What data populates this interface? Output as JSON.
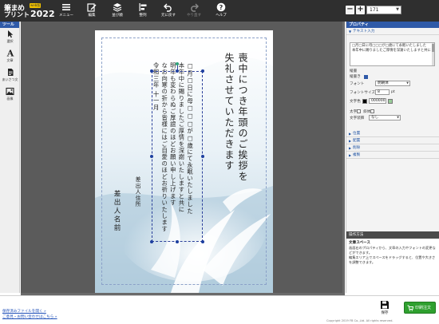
{
  "app": {
    "logo_line1": "筆まめ",
    "logo_line2": "プリント",
    "logo_tag": "web版",
    "logo_year": "2022"
  },
  "toolbar": {
    "menu": "メニュー",
    "edit": "編集",
    "layer": "並び順",
    "align": "整列",
    "undo": "元に戻す",
    "redo": "やり直す",
    "help": "ヘルプ",
    "zoom_value": "171"
  },
  "tools": {
    "header": "ツール",
    "select": "選択",
    "text": "文章",
    "greeting": "あいさつ文",
    "image": "画像"
  },
  "card": {
    "title_lines": [
      "喪中につき年頭のご挨拶を",
      "失礼させていただきます"
    ],
    "body_lines": [
      "本年中に賜りましたご厚情を深謝いたしますと共に",
      "明年も変わらぬご厚誼のほどお願い申し上げます",
      "なお向寒の折から皆様にはご自愛のほどお祈りいたします"
    ],
    "body_head": "□月□日に母□□□が□歳にて永眠いたしました",
    "date": "令和三年 十一月",
    "sender_address": "差出人住所",
    "sender_name": "差出人名前"
  },
  "properties": {
    "header": "プロパティ",
    "text_input_section": "テキスト入力",
    "text_content": "□月□日に母□□□が□歳にて永眠いたしました\n本年中に賜りましたご厚情を深謝いたしますと共に",
    "vertical_label": "縦書",
    "vertical_checkbox_label": "縦書き",
    "font_label": "フォント",
    "font_value": "明朝体",
    "font_size_label": "フォントサイズ",
    "font_size_value": "8",
    "font_size_unit": "pt",
    "text_color_label": "文字色",
    "text_color_value": "000000",
    "bold_label": "太字",
    "italic_label": "斜体",
    "decoration_label": "文字装飾",
    "decoration_value": "なし",
    "sections": [
      "位置",
      "配置",
      "削除",
      "複製"
    ]
  },
  "help": {
    "header": "操作方法",
    "title": "文章スペース",
    "body": "画面右のプロパティから、文章の入力やフォントの変更などができます。\n編集エリア上でスペースをドラッグすると、位置や大きさを調整できます。"
  },
  "bottom": {
    "link_open": "保存済みファイルを開く »",
    "link_sample": "ご意見・お問い合わせはこちら »",
    "save": "保存",
    "print": "印刷注文",
    "copyright": "Copyright 2019 FB Co.,Ltd. All rights reserved."
  },
  "colors": {
    "toolbar_bg": "#2f2f2f",
    "panel_header": "#2f5aa8",
    "canvas_bg": "#5b5b5b",
    "print_button": "#2fa02f"
  }
}
